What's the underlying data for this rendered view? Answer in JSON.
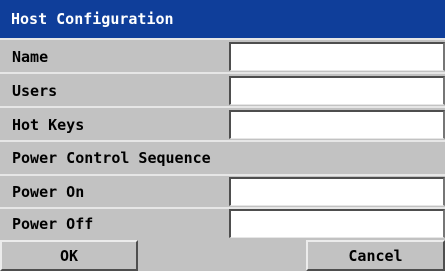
{
  "dialog": {
    "title": "Host Configuration",
    "fields": [
      {
        "label": "Name",
        "value": ""
      },
      {
        "label": "Users",
        "value": ""
      },
      {
        "label": "Hot Keys",
        "value": ""
      }
    ],
    "section_label": "Power Control Sequence",
    "power_fields": [
      {
        "label": "Power On",
        "value": ""
      },
      {
        "label": "Power Off",
        "value": ""
      }
    ],
    "buttons": {
      "ok": "OK",
      "cancel": "Cancel"
    }
  }
}
